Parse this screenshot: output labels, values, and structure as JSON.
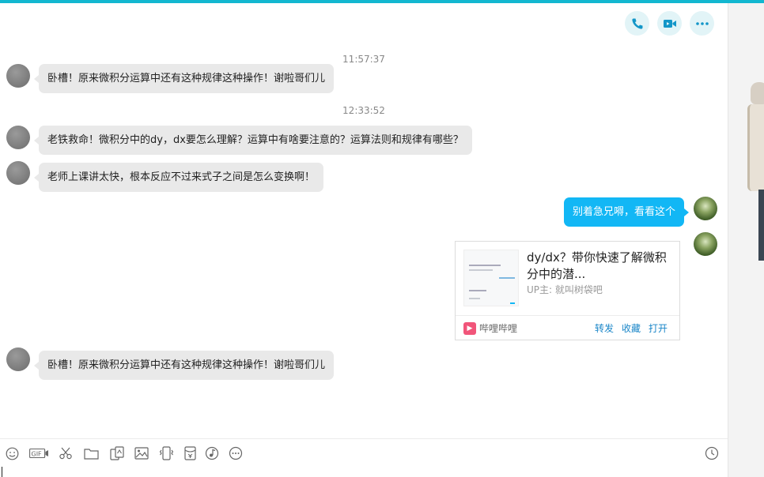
{
  "header": {
    "icons": [
      "phone-icon",
      "video-call-icon",
      "more-icon"
    ],
    "accent_color": "#12b7d0"
  },
  "messages": [
    {
      "time": "11:57:37"
    },
    {
      "sender": "other",
      "text": "卧槽！原来微积分运算中还有这种规律这种操作！谢啦哥们儿"
    },
    {
      "time": "12:33:52"
    },
    {
      "sender": "other",
      "text": "老铁救命！微积分中的dy，dx要怎么理解？运算中有啥要注意的？运算法则和规律有哪些？"
    },
    {
      "sender": "other",
      "text": "老师上课讲太快，根本反应不过来式子之间是怎么变换啊！"
    },
    {
      "sender": "self",
      "text": "别着急兄嘚，看看这个"
    },
    {
      "sender": "self",
      "card": {
        "title": "dy/dx？带你快速了解微积分中的潜...",
        "uploader": "UP主: 就叫树袋吧",
        "source": "哔哩哔哩",
        "actions": [
          "转发",
          "收藏",
          "打开"
        ]
      }
    },
    {
      "sender": "other",
      "text": "卧槽！原来微积分运算中还有这种规律这种操作！谢啦哥们儿"
    }
  ],
  "bubble_self_color": "#12b7f5",
  "bubble_other_color": "#e9e9e9",
  "toolbar": {
    "icons": [
      "emoji-icon",
      "gif-icon",
      "scissors-icon",
      "folder-icon",
      "sticker-icon",
      "image-icon",
      "shake-icon",
      "red-packet-icon",
      "music-icon",
      "more-options-icon",
      "history-icon"
    ]
  }
}
